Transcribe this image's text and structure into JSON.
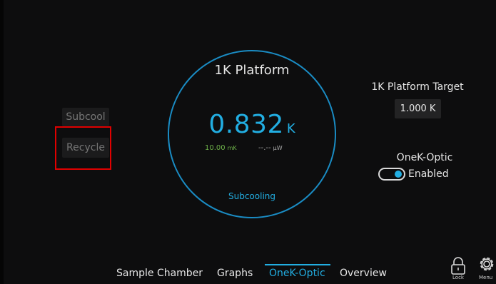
{
  "left_controls": {
    "subcool_label": "Subcool",
    "recycle_label": "Recycle"
  },
  "dial": {
    "title": "1K Platform",
    "temperature": "0.832",
    "temperature_unit": "K",
    "setpoint_value": "10.00",
    "setpoint_unit": "mK",
    "power_value": "--.--",
    "power_unit": "µW",
    "status": "Subcooling"
  },
  "target": {
    "label": "1K Platform Target",
    "value": "1.000 K"
  },
  "onek_optic": {
    "label": "OneK-Optic",
    "toggle_state": "Enabled",
    "enabled": true
  },
  "nav": {
    "tabs": [
      "Sample Chamber",
      "Graphs",
      "OneK-Optic",
      "Overview"
    ],
    "active_tab": "OneK-Optic"
  },
  "corner_controls": {
    "lock_label": "Lock",
    "menu_label": "Menu"
  },
  "colors": {
    "accent": "#22aee2",
    "ring": "#1a8cc4",
    "setpoint_green": "#6fb34a",
    "highlight": "#e00000",
    "background": "#0d0d0e"
  },
  "icons": [
    "lock-icon",
    "gear-icon"
  ]
}
